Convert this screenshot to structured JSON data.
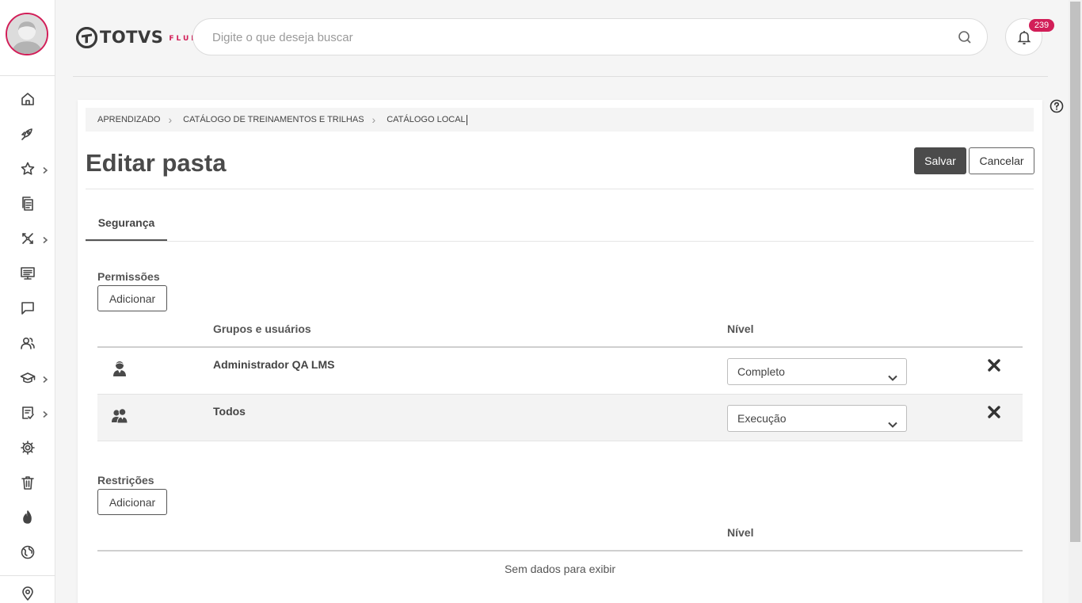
{
  "brand": {
    "name": "TOTVS",
    "sub": "FLUIG",
    "accent": "#d21e58"
  },
  "search": {
    "placeholder": "Digite o que deseja buscar"
  },
  "notifications": {
    "count": "239"
  },
  "sidebar": {
    "items": [
      {
        "icon": "home-icon"
      },
      {
        "icon": "rocket-icon"
      },
      {
        "icon": "star-icon",
        "has_submenu": true
      },
      {
        "icon": "documents-icon"
      },
      {
        "icon": "workflow-icon",
        "has_submenu": true
      },
      {
        "icon": "monitor-icon"
      },
      {
        "icon": "chat-icon"
      },
      {
        "icon": "users-icon"
      },
      {
        "icon": "graduation-cap-icon",
        "has_submenu": true
      },
      {
        "icon": "task-icon",
        "has_submenu": true
      },
      {
        "icon": "gear-icon"
      },
      {
        "icon": "trash-icon"
      },
      {
        "icon": "flame-icon"
      },
      {
        "icon": "globe-icon"
      },
      {
        "icon": "location-pin-icon"
      }
    ]
  },
  "breadcrumb": [
    "APRENDIZADO",
    "CATÁLOGO DE TREINAMENTOS E TRILHAS",
    "CATÁLOGO LOCAL"
  ],
  "page": {
    "title": "Editar pasta",
    "save_label": "Salvar",
    "cancel_label": "Cancelar"
  },
  "tabs": [
    {
      "label": "Segurança",
      "active": true
    }
  ],
  "permissions": {
    "title": "Permissões",
    "add_label": "Adicionar",
    "columns": {
      "groups": "Grupos e usuários",
      "level": "Nível"
    },
    "rows": [
      {
        "type": "user",
        "name": "Administrador QA LMS",
        "level": "Completo"
      },
      {
        "type": "group",
        "name": "Todos",
        "level": "Execução"
      }
    ]
  },
  "restrictions": {
    "title": "Restrições",
    "add_label": "Adicionar",
    "columns": {
      "level": "Nível"
    },
    "empty_text": "Sem dados para exibir"
  }
}
